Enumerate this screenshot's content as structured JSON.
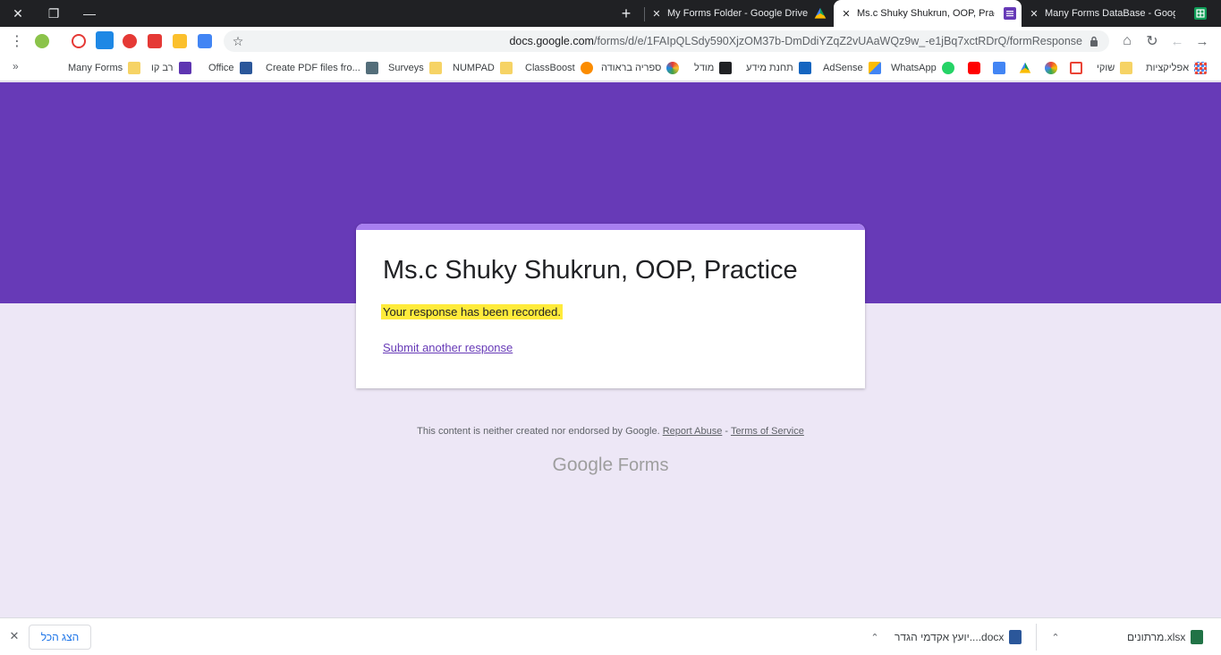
{
  "browser": {
    "window_controls": {
      "close": "✕",
      "restore": "❐",
      "minimize": "—"
    },
    "new_tab": "+",
    "tabs": [
      {
        "title": "My Forms Folder - Google Drive",
        "favicon": "google-drive-icon",
        "active": false
      },
      {
        "title": "Ms.c Shuky Shukrun, OOP, Practice",
        "favicon": "google-forms-icon",
        "active": true
      },
      {
        "title": "Many Forms DataBase - Google Sheets",
        "favicon": "google-sheets-icon",
        "active": false
      }
    ],
    "tab_close": "✕",
    "toolbar": {
      "menu": "⋮",
      "star": "☆",
      "home": "⌂",
      "reload": "↻",
      "back": "←",
      "forward": "→",
      "url_host": "docs.google.com",
      "url_path": "/forms/d/e/1FAIpQLSdy590XjzOM37b-DmDdiYZqZ2vUAaWQz9w_-e1jBq7xctRDrQ/formResponse"
    },
    "bookmarks": {
      "more": "»",
      "items": [
        {
          "label": "Many Forms",
          "icon": "folder-icon"
        },
        {
          "label": "רב קו",
          "icon": "ravkav-icon"
        },
        {
          "label": "Office",
          "icon": "word-icon"
        },
        {
          "label": "Create PDF files fro...",
          "icon": "pdf-icon"
        },
        {
          "label": "Surveys",
          "icon": "folder-icon"
        },
        {
          "label": "NUMPAD",
          "icon": "folder-icon"
        },
        {
          "label": "ClassBoost",
          "icon": "classboost-icon"
        },
        {
          "label": "ספריה בראודה",
          "icon": "library-icon"
        },
        {
          "label": "מודל",
          "icon": "moodle-icon"
        },
        {
          "label": "תחנת מידע",
          "icon": "info-station-icon"
        },
        {
          "label": "AdSense",
          "icon": "adsense-icon"
        },
        {
          "label": "WhatsApp",
          "icon": "whatsapp-icon"
        },
        {
          "label": "",
          "icon": "youtube-icon"
        },
        {
          "label": "",
          "icon": "translate-icon"
        },
        {
          "label": "",
          "icon": "google-drive-icon"
        },
        {
          "label": "",
          "icon": "google-photos-icon"
        },
        {
          "label": "",
          "icon": "gmail-icon"
        },
        {
          "label": "שוקי",
          "icon": "folder-icon"
        },
        {
          "label": "אפליקציות",
          "icon": "apps-grid-icon"
        }
      ]
    }
  },
  "colors": {
    "form_theme": "#673ab7",
    "card_accent": "#a87ff0",
    "page_background": "#ede7f6",
    "highlight": "#ffeb3b"
  },
  "form": {
    "title": "Ms.c Shuky Shukrun, OOP, Practice",
    "confirmation": "Your response has been recorded.",
    "submit_another": "Submit another response"
  },
  "footer": {
    "disclaimer": "This content is neither created nor endorsed by Google.",
    "report_abuse": "Report Abuse",
    "separator": " - ",
    "terms": "Terms of Service",
    "brand_google": "Google",
    "brand_forms": "Forms"
  },
  "downloads": {
    "close": "✕",
    "show_all": "הצג הכל",
    "items": [
      {
        "name": "יועץ אקדמי הגדר....docx",
        "icon": "word-doc-icon",
        "chevron": "⌃"
      },
      {
        "name": "מרתונים.xlsx",
        "icon": "excel-icon",
        "chevron": "⌃"
      }
    ]
  }
}
